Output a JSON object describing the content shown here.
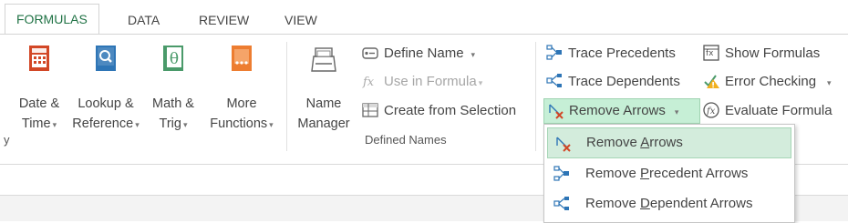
{
  "tabs": [
    {
      "label": "FORMULAS",
      "active": true
    },
    {
      "label": "DATA"
    },
    {
      "label": "REVIEW"
    },
    {
      "label": "VIEW"
    }
  ],
  "function_library": {
    "date_time": {
      "line1": "Date &",
      "line2": "Time",
      "caret": "▾"
    },
    "lookup_reference": {
      "line1": "Lookup &",
      "line2": "Reference",
      "caret": "▾"
    },
    "math_trig": {
      "line1": "Math &",
      "line2": "Trig",
      "caret": "▾"
    },
    "more_functions": {
      "line1": "More",
      "line2": "Functions",
      "caret": "▾"
    },
    "group_label_fragment": "y"
  },
  "defined_names": {
    "name_manager": {
      "line1": "Name",
      "line2": "Manager"
    },
    "define_name": "Define Name",
    "use_in_formula": "Use in Formula",
    "create_from_selection": "Create from Selection",
    "group_label": "Defined Names"
  },
  "formula_auditing": {
    "trace_precedents": "Trace Precedents",
    "trace_dependents": "Trace Dependents",
    "remove_arrows": "Remove Arrows",
    "show_formulas": "Show Formulas",
    "error_checking": "Error Checking",
    "evaluate_formula": "Evaluate Formula"
  },
  "remove_arrows_menu": {
    "item1": {
      "before": "Remove ",
      "underlined": "A",
      "after": "rrows"
    },
    "item2": {
      "before": "Remove ",
      "underlined": "P",
      "after": "recedent Arrows"
    },
    "item3": {
      "before": "Remove ",
      "underlined": "D",
      "after": "ependent Arrows"
    }
  },
  "colors": {
    "accent": "#217346",
    "date_icon": "#d24726",
    "lookup_icon": "#2e75b6",
    "math_icon": "#4a9a6a",
    "more_icon": "#ed7d31",
    "highlight": "#c6efd6"
  }
}
